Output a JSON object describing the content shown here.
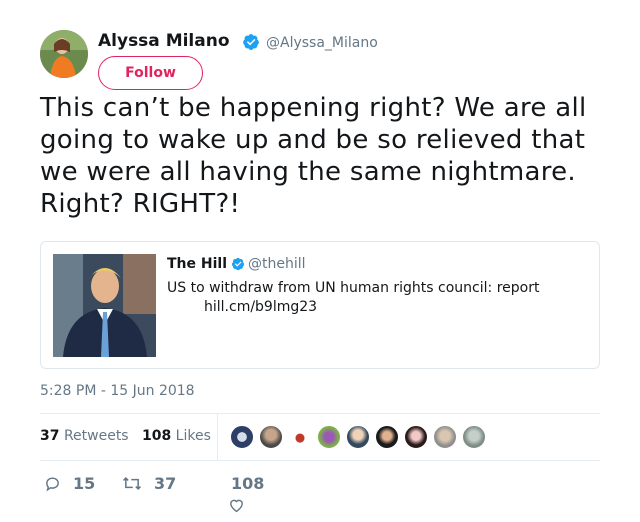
{
  "user": {
    "display_name": "Alyssa Milano",
    "handle": "@Alyssa_Milano",
    "follow_label": "Follow"
  },
  "tweet": {
    "text": "This can’t be happening right? We are all going to wake up and be so relieved that we were all having the same nightmare. Right? RIGHT?!",
    "timestamp": "5:28 PM - 15 Jun 2018"
  },
  "quote": {
    "name": "The Hill",
    "handle": "@thehill",
    "text": "US to withdraw from UN human rights council: report",
    "link": "hill.cm/b9lmg23"
  },
  "stats": {
    "retweets_count": "37",
    "retweets_label": "Retweets",
    "likes_count": "108",
    "likes_label": "Likes"
  },
  "actions": {
    "reply_count": "15",
    "retweet_count": "37",
    "like_count": "108"
  },
  "colors": {
    "accent": "#e0245e",
    "verified": "#1da1f2",
    "muted": "#657786"
  }
}
